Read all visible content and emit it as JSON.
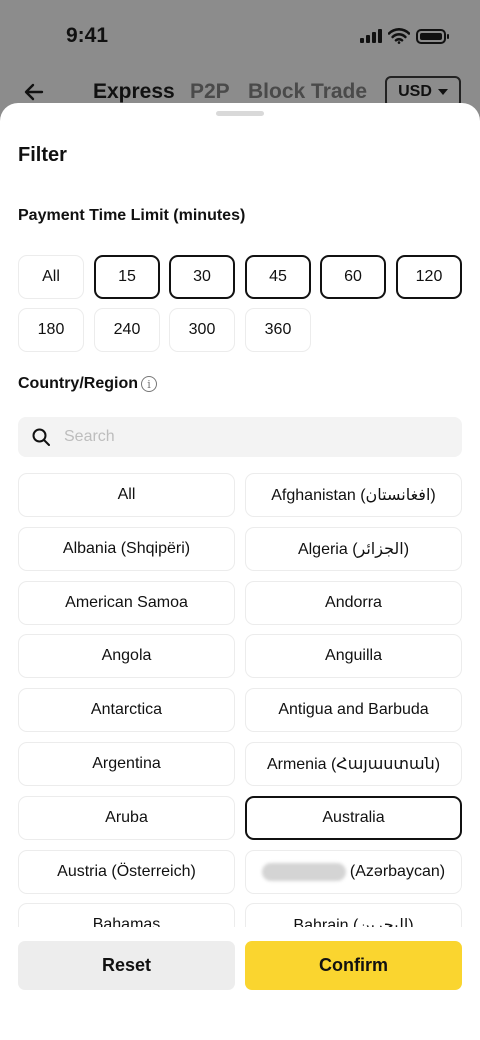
{
  "status_bar": {
    "time": "9:41"
  },
  "nav": {
    "tabs": [
      {
        "label": "Express",
        "active": true
      },
      {
        "label": "P2P",
        "active": false
      },
      {
        "label": "Block Trade",
        "active": false
      }
    ],
    "currency": "USD"
  },
  "sheet": {
    "title": "Filter",
    "payment_time": {
      "label": "Payment Time Limit (minutes)",
      "options": [
        {
          "label": "All",
          "selected": false
        },
        {
          "label": "15",
          "selected": true
        },
        {
          "label": "30",
          "selected": true
        },
        {
          "label": "45",
          "selected": true
        },
        {
          "label": "60",
          "selected": true
        },
        {
          "label": "120",
          "selected": true
        },
        {
          "label": "180",
          "selected": false
        },
        {
          "label": "240",
          "selected": false
        },
        {
          "label": "300",
          "selected": false
        },
        {
          "label": "360",
          "selected": false
        }
      ]
    },
    "country": {
      "label": "Country/Region",
      "search_placeholder": "Search",
      "items": [
        {
          "label": "All",
          "selected": false
        },
        {
          "label": "Afghanistan (افغانستان)",
          "selected": false
        },
        {
          "label": "Albania (Shqipëri)",
          "selected": false
        },
        {
          "label": "Algeria (الجزائر)",
          "selected": false
        },
        {
          "label": "American Samoa",
          "selected": false
        },
        {
          "label": "Andorra",
          "selected": false
        },
        {
          "label": "Angola",
          "selected": false
        },
        {
          "label": "Anguilla",
          "selected": false
        },
        {
          "label": "Antarctica",
          "selected": false
        },
        {
          "label": "Antigua and Barbuda",
          "selected": false
        },
        {
          "label": "Argentina",
          "selected": false
        },
        {
          "label": "Armenia (Հայաստան)",
          "selected": false
        },
        {
          "label": "Aruba",
          "selected": false
        },
        {
          "label": "Australia",
          "selected": true
        },
        {
          "label": "Austria (Österreich)",
          "selected": false
        },
        {
          "label": "(Azərbaycan)",
          "selected": false,
          "redacted_prefix": true
        },
        {
          "label": "Bahamas",
          "selected": false
        },
        {
          "label": "Bahrain (البحرين)",
          "selected": false
        }
      ]
    }
  },
  "footer": {
    "reset_label": "Reset",
    "confirm_label": "Confirm"
  },
  "colors": {
    "accent": "#fad52f",
    "selected_border": "#111111",
    "chip_border": "#ececec",
    "overlay": "#8c8c8c"
  },
  "icons": [
    "back-arrow-icon",
    "search-icon",
    "info-icon",
    "wifi-icon",
    "signal-icon",
    "battery-icon",
    "caret-down-icon"
  ]
}
